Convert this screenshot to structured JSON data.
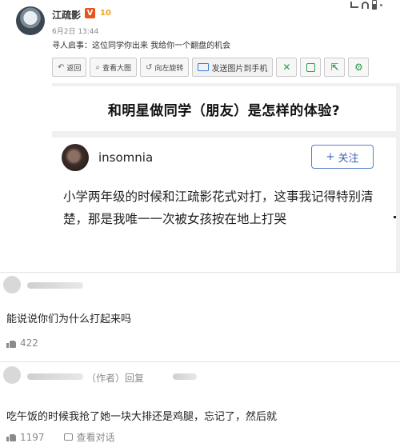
{
  "post": {
    "username": "江疏影",
    "vip_badge": "V",
    "rank_badge": "10",
    "timestamp": "6月2日 13:44",
    "text": "寻人启事：这位同学你出来 我给你一个翻盘的机会"
  },
  "toolbar": {
    "return_label": "返回",
    "view_large_label": "查看大图",
    "rotate_left_label": "向左旋转",
    "send_to_phone_label": "发送图片到手机",
    "icons": [
      "shuffle-icon",
      "save-icon",
      "share-icon",
      "settings-icon"
    ]
  },
  "screenshot": {
    "question_title": "和明星做同学（朋友）是怎样的体验?",
    "answer_author": "insomnia",
    "follow_label": "关注",
    "answer_text": "小学两年级的时候和江疏影花式对打，这事我记得特别清楚，那是我唯一一次被女孩按在地上打哭"
  },
  "comments": [
    {
      "text": "能说说你们为什么打起来吗",
      "likes": "422"
    },
    {
      "author_tag": "（作者）回复",
      "text": "吃午饭的时候我抢了她一块大排还是鸡腿，忘记了，然后就",
      "likes": "1197",
      "view_dialogue": "查看对话"
    }
  ],
  "colors": {
    "follow_blue": "#3a64b8",
    "toolbar_green": "#2d9c4b",
    "vip_orange": "#e8541e"
  }
}
